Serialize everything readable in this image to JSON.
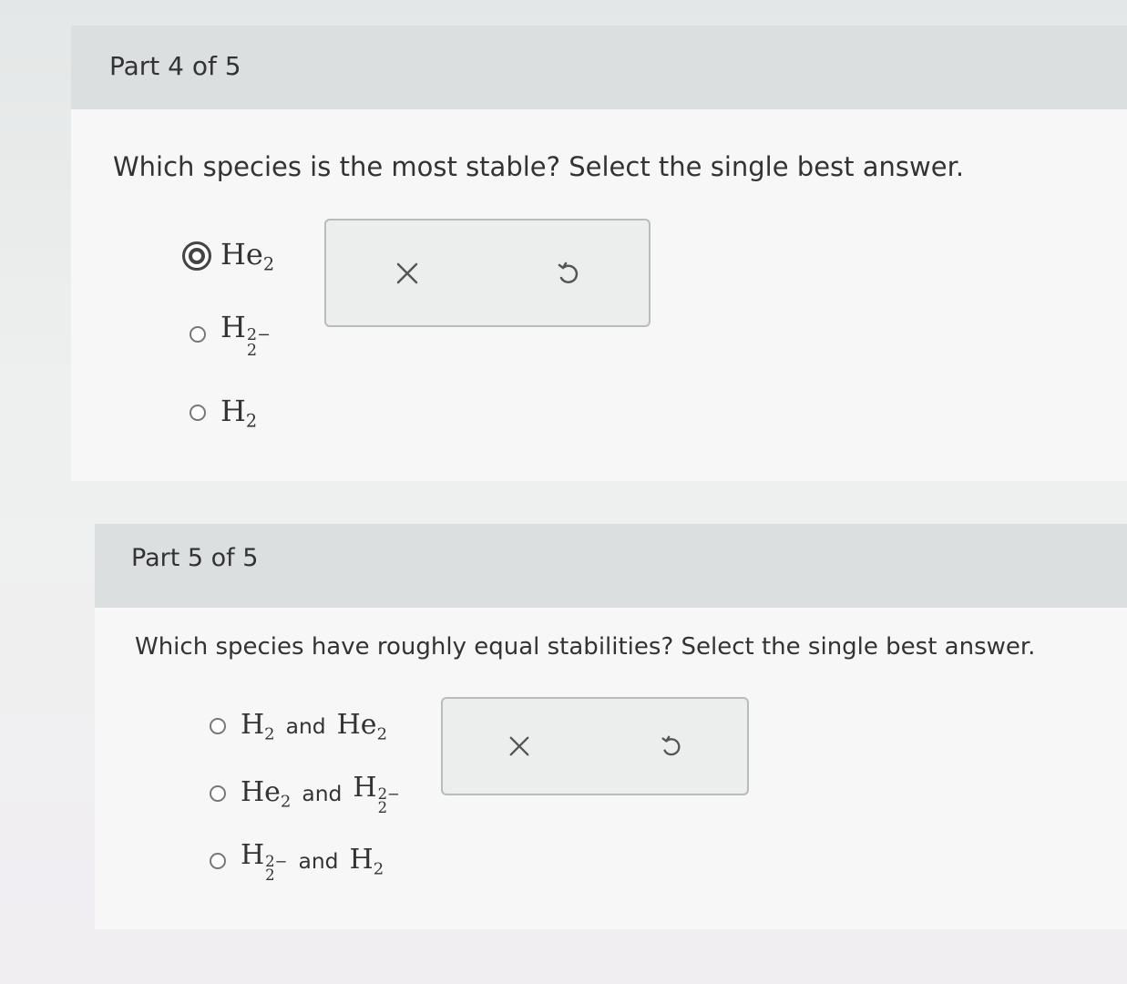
{
  "parts": [
    {
      "title": "Part 4 of 5",
      "question": "Which species is the most stable? Select the single best answer.",
      "options": [
        {
          "base": "He",
          "sub": "2",
          "sup": "",
          "selected": true
        },
        {
          "base": "H",
          "sub": "2",
          "sup": "2−",
          "selected": false
        },
        {
          "base": "H",
          "sub": "2",
          "sup": "",
          "selected": false
        }
      ],
      "actions": {
        "clear_icon": "close-icon",
        "reset_icon": "undo-icon"
      }
    },
    {
      "title": "Part 5 of 5",
      "question": "Which species have roughly equal stabilities? Select the single best answer.",
      "conjunction": "and",
      "options": [
        {
          "a_base": "H",
          "a_sub": "2",
          "a_sup": "",
          "b_base": "He",
          "b_sub": "2",
          "b_sup": "",
          "selected": false
        },
        {
          "a_base": "He",
          "a_sub": "2",
          "a_sup": "",
          "b_base": "H",
          "b_sub": "2",
          "b_sup": "2−",
          "selected": false
        },
        {
          "a_base": "H",
          "a_sub": "2",
          "a_sup": "2−",
          "b_base": "H",
          "b_sub": "2",
          "b_sup": "",
          "selected": false
        }
      ],
      "actions": {
        "clear_icon": "close-icon",
        "reset_icon": "undo-icon"
      }
    }
  ],
  "colors": {
    "icon": "#555555",
    "header_bg": "#dcdfdf",
    "panel_bg": "#f6f7f6"
  }
}
